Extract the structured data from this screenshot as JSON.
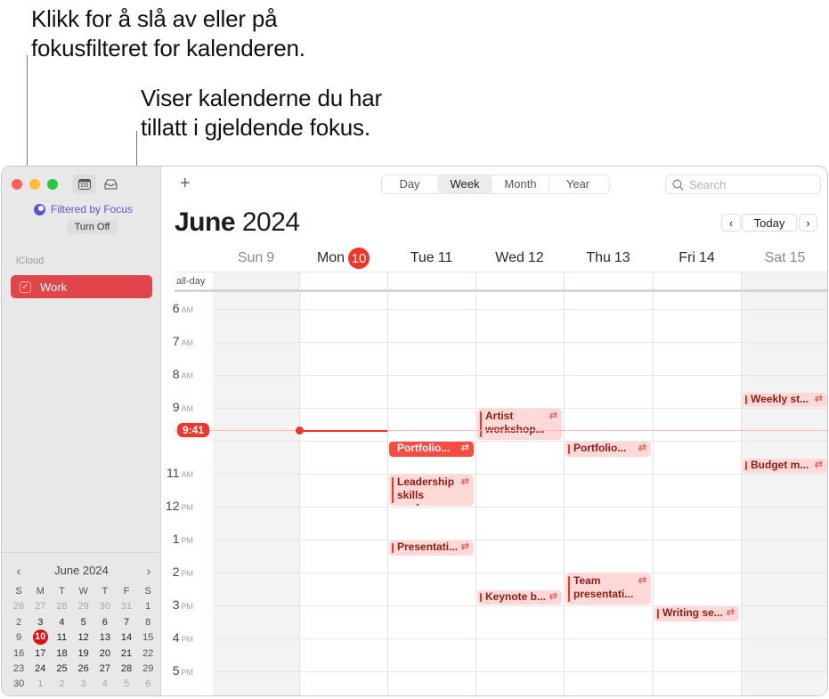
{
  "callouts": [
    {
      "line1": "Klikk for å slå av eller på",
      "line2": "fokusfilteret for kalenderen."
    },
    {
      "line1": "Viser kalenderne du har",
      "line2": "tillatt i gjeldende fokus."
    }
  ],
  "sidebar": {
    "focus_status": "Filtered by Focus",
    "turn_off_label": "Turn Off",
    "section_label": "iCloud",
    "calendars": [
      {
        "label": "Work",
        "checked": true,
        "color": "#e0454b"
      }
    ],
    "mini_calendar": {
      "title": "June 2024",
      "prev": "‹",
      "next": "›",
      "weekdays": [
        "S",
        "M",
        "T",
        "W",
        "T",
        "F",
        "S"
      ],
      "weeks": [
        [
          "26",
          "27",
          "28",
          "29",
          "30",
          "31",
          "1"
        ],
        [
          "2",
          "3",
          "4",
          "5",
          "6",
          "7",
          "8"
        ],
        [
          "9",
          "10",
          "11",
          "12",
          "13",
          "14",
          "15"
        ],
        [
          "16",
          "17",
          "18",
          "19",
          "20",
          "21",
          "22"
        ],
        [
          "23",
          "24",
          "25",
          "26",
          "27",
          "28",
          "29"
        ],
        [
          "30",
          "1",
          "2",
          "3",
          "4",
          "5",
          "6"
        ]
      ],
      "today": "10"
    }
  },
  "toolbar": {
    "add_label": "+",
    "views": [
      "Day",
      "Week",
      "Month",
      "Year"
    ],
    "active_view": "Week",
    "search_placeholder": "Search"
  },
  "header": {
    "month": "June",
    "year": "2024",
    "prev": "‹",
    "today_label": "Today",
    "next": "›"
  },
  "days": [
    {
      "name": "Sun",
      "date": "9",
      "weekend": true
    },
    {
      "name": "Mon",
      "date": "10",
      "today": true
    },
    {
      "name": "Tue",
      "date": "11"
    },
    {
      "name": "Wed",
      "date": "12"
    },
    {
      "name": "Thu",
      "date": "13"
    },
    {
      "name": "Fri",
      "date": "14"
    },
    {
      "name": "Sat",
      "date": "15",
      "weekend": true
    }
  ],
  "allday_label": "all-day",
  "hours": [
    {
      "h": "6",
      "p": "AM"
    },
    {
      "h": "7",
      "p": "AM"
    },
    {
      "h": "8",
      "p": "AM"
    },
    {
      "h": "9",
      "p": "AM"
    },
    {
      "h": "",
      "p": ""
    },
    {
      "h": "11",
      "p": "AM"
    },
    {
      "h": "12",
      "p": "PM"
    },
    {
      "h": "1",
      "p": "PM"
    },
    {
      "h": "2",
      "p": "PM"
    },
    {
      "h": "3",
      "p": "PM"
    },
    {
      "h": "4",
      "p": "PM"
    },
    {
      "h": "5",
      "p": "PM"
    }
  ],
  "current_time": "9:41",
  "current_time_hours": 9.683,
  "events": [
    {
      "title": "Artist workshop...",
      "lines": [
        "Artist",
        "workshop..."
      ],
      "day": 2,
      "start": 9.0,
      "end": 10.0,
      "repeat": true,
      "solid": false
    },
    {
      "title": "Weekly st...",
      "lines": [
        "Weekly st..."
      ],
      "day": 5,
      "start": 8.5,
      "end": 9.0,
      "repeat": true,
      "solid": false
    },
    {
      "title": "Portfolio...",
      "lines": [
        "Portfolio..."
      ],
      "day": 1,
      "start": 10.0,
      "end": 10.5,
      "repeat": true,
      "solid": true
    },
    {
      "title": "Portfolio...",
      "lines": [
        "Portfolio..."
      ],
      "day": 3,
      "start": 10.0,
      "end": 10.5,
      "repeat": true,
      "solid": false
    },
    {
      "title": "Budget m...",
      "lines": [
        "Budget m..."
      ],
      "day": 5,
      "start": 10.5,
      "end": 11.0,
      "repeat": true,
      "solid": false
    },
    {
      "title": "Leadership skills work...",
      "lines": [
        "Leadership",
        "skills work..."
      ],
      "day": 1,
      "start": 11.0,
      "end": 12.0,
      "repeat": true,
      "solid": false
    },
    {
      "title": "Presentati...",
      "lines": [
        "Presentati..."
      ],
      "day": 1,
      "start": 13.0,
      "end": 13.5,
      "repeat": true,
      "solid": false
    },
    {
      "title": "Team presentati...",
      "lines": [
        "Team",
        "presentati..."
      ],
      "day": 3,
      "start": 14.0,
      "end": 15.0,
      "repeat": true,
      "solid": false
    },
    {
      "title": "Keynote b...",
      "lines": [
        "Keynote b..."
      ],
      "day": 2,
      "start": 14.5,
      "end": 15.0,
      "repeat": true,
      "solid": false
    },
    {
      "title": "Writing se...",
      "lines": [
        "Writing se..."
      ],
      "day": 4,
      "start": 15.0,
      "end": 15.5,
      "repeat": true,
      "solid": false
    }
  ],
  "icons": {
    "repeat": "⇄",
    "check": "✓",
    "search": "search-icon",
    "calendar_view": "calendar-icon",
    "inbox": "inbox-icon",
    "focus": "moon-icon"
  }
}
